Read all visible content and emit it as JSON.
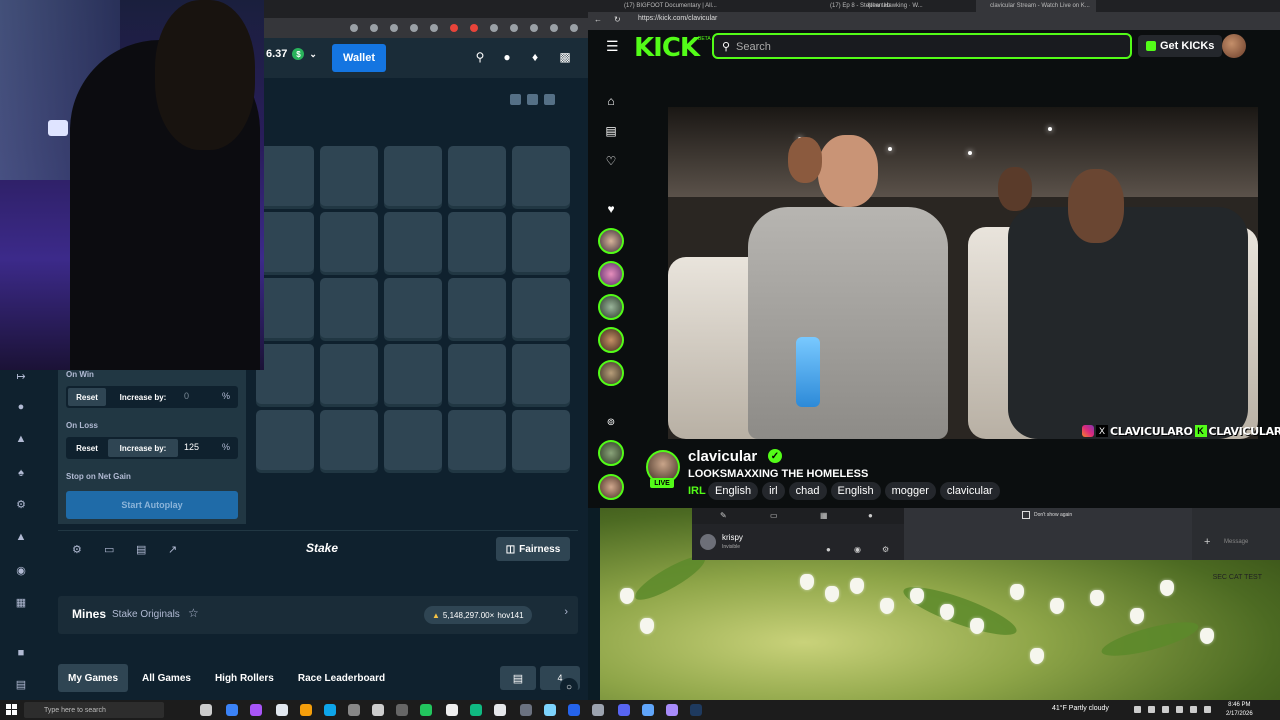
{
  "stake": {
    "balance": "6.37",
    "currency_symbol": "$",
    "wallet_label": "Wallet",
    "on_win_label": "On Win",
    "on_loss_label": "On Loss",
    "reset_label": "Reset",
    "increase_label": "Increase by:",
    "on_win_value": "0",
    "on_loss_value": "125",
    "percent": "%",
    "stop_net_gain_label": "Stop on Net Gain",
    "autoplay_label": "Start Autoplay",
    "logo": "Stake",
    "fairness_label": "Fairness",
    "game_title": "Mines",
    "game_subtitle": "Stake Originals",
    "record_value": "5,148,297.00×",
    "record_user": "hov141",
    "tabs": [
      "My Games",
      "All Games",
      "High Rollers",
      "Race Leaderboard"
    ],
    "tab_overflow": "4"
  },
  "kick": {
    "tabs": [
      "(17) BIGFOOT Documentary | All...",
      "(17) Ep 8 - Stephen Hawking · W...",
      "New tab",
      "clavicular Stream - Watch Live on K..."
    ],
    "url": "https://kick.com/clavicular",
    "logo": "KICK",
    "beta": "BETA",
    "search_placeholder": "Search",
    "get_kicks_label": "Get KICKs",
    "streamer_name": "clavicular",
    "live_label": "LIVE",
    "stream_title": "LOOKSMAXXING THE HOMELESS",
    "category": "IRL",
    "tags": [
      "English",
      "irl",
      "chad",
      "English",
      "mogger",
      "clavicular"
    ],
    "overlay_handle": "CLAVICULARO",
    "overlay_handle_2": "CLAVICULAR"
  },
  "discord": {
    "username": "krispy",
    "status": "Invisible",
    "dont_show_again": "Don't show again",
    "message_placeholder": "Message"
  },
  "taskbar": {
    "search_placeholder": "Type here to search",
    "weather": "41°F  Partly cloudy",
    "time": "8:46 PM",
    "date": "2/17/2026"
  },
  "desktop": {
    "sticky_label": "SEC CAT TEST"
  },
  "colors": {
    "stake_bg": "#0f212e",
    "stake_panel": "#213743",
    "stake_tile": "#2f4553",
    "stake_blue": "#1475e1",
    "kick_green": "#53fc18",
    "kick_bg": "#0b0e0f"
  }
}
